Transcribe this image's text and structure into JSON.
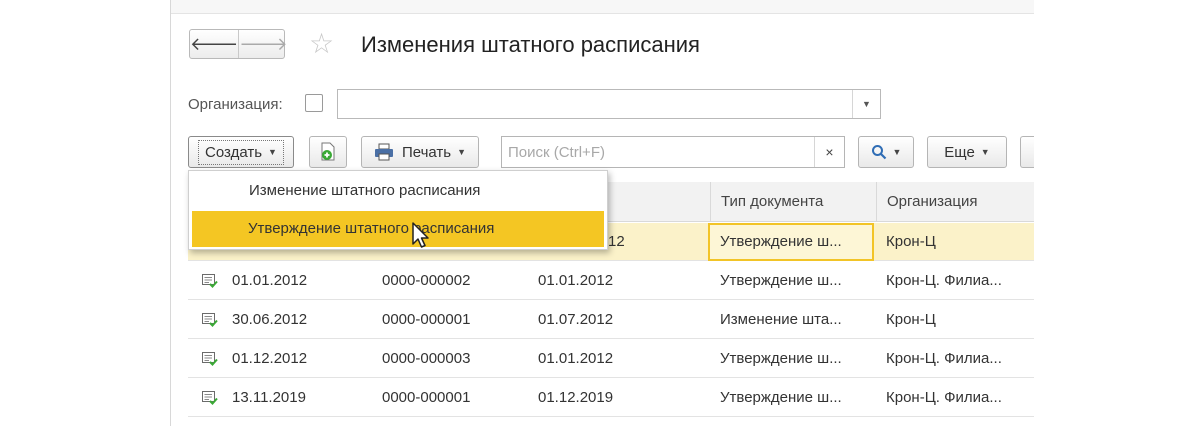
{
  "header": {
    "title": "Изменения штатного расписания",
    "back_icon": "arrow-left-icon",
    "forward_icon": "arrow-right-icon",
    "favorite_icon": "star-icon"
  },
  "filter": {
    "org_label": "Организация:",
    "org_value": ""
  },
  "toolbar": {
    "create_label": "Создать",
    "print_label": "Печать",
    "search_placeholder": "Поиск (Ctrl+F)",
    "clear_label": "×",
    "more_label": "Еще"
  },
  "create_menu": {
    "items": [
      {
        "label": "Изменение штатного расписания"
      },
      {
        "label": "Утверждение штатного расписания"
      }
    ]
  },
  "table": {
    "columns": [
      "Тип документа",
      "Организация"
    ],
    "rows": [
      {
        "date": "",
        "number": "",
        "effective": "12",
        "type": "Утверждение ш...",
        "org": "Крон-Ц"
      },
      {
        "date": "01.01.2012",
        "number": "0000-000002",
        "effective": "01.01.2012",
        "type": "Утверждение ш...",
        "org": "Крон-Ц. Филиа..."
      },
      {
        "date": "30.06.2012",
        "number": "0000-000001",
        "effective": "01.07.2012",
        "type": "Изменение шта...",
        "org": "Крон-Ц"
      },
      {
        "date": "01.12.2012",
        "number": "0000-000003",
        "effective": "01.01.2012",
        "type": "Утверждение ш...",
        "org": "Крон-Ц. Филиа..."
      },
      {
        "date": "13.11.2019",
        "number": "0000-000001",
        "effective": "01.12.2019",
        "type": "Утверждение ш...",
        "org": "Крон-Ц. Филиа..."
      }
    ]
  },
  "colors": {
    "highlight": "#f4c623",
    "selected_row": "#fbf2c9",
    "doc_icon_green": "#3aa935"
  }
}
